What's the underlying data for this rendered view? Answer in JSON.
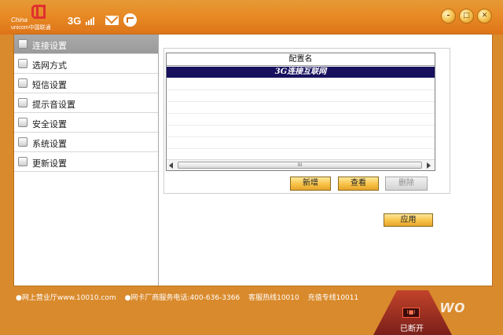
{
  "header": {
    "logo_text_line1": "China",
    "logo_text_line2": "unicom中国联通",
    "network_badge": "3G",
    "icons": [
      "signal-icon",
      "mail-icon",
      "refresh-icon",
      "minimize-icon",
      "restore-icon",
      "close-icon"
    ],
    "win_minimize_glyph": "–",
    "win_restore_glyph": "□",
    "win_close_glyph": "✕"
  },
  "sidebar": {
    "items": [
      {
        "label": "连接设置",
        "active": true
      },
      {
        "label": "选网方式",
        "active": false
      },
      {
        "label": "短信设置",
        "active": false
      },
      {
        "label": "提示音设置",
        "active": false
      },
      {
        "label": "安全设置",
        "active": false
      },
      {
        "label": "系统设置",
        "active": false
      },
      {
        "label": "更新设置",
        "active": false
      }
    ]
  },
  "profiles": {
    "column_header": "配置名",
    "rows": [
      "3G连接互联网"
    ],
    "scroll_grip": "III"
  },
  "actions": {
    "new_label": "新增",
    "view_label": "查看",
    "delete_label": "删除",
    "apply_label": "应用"
  },
  "footer": {
    "item1": "●网上营业厅www.10010.com",
    "item2": "●网卡厂商服务电话:400-636-3366",
    "item3": "客服热线10010",
    "item4": "充值专线10011",
    "status_label": "已断开",
    "status_icon_text": "I■I",
    "brand_mark": "wo"
  },
  "colors": {
    "accent_orange": "#e88a25",
    "selected_row": "#17115e",
    "button_gold": "#f7c347"
  }
}
